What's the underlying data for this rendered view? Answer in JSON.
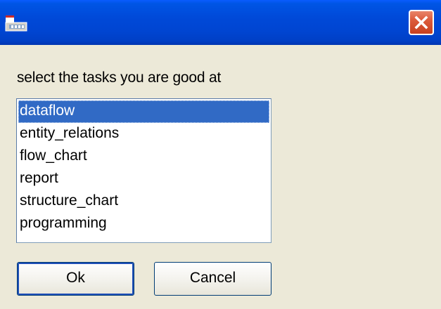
{
  "window": {
    "title": "",
    "close_icon": "close-icon"
  },
  "dialog": {
    "prompt": "select the tasks you are good at",
    "tasks": [
      {
        "label": "dataflow",
        "selected": true
      },
      {
        "label": "entity_relations",
        "selected": false
      },
      {
        "label": "flow_chart",
        "selected": false
      },
      {
        "label": "report",
        "selected": false
      },
      {
        "label": "structure_chart",
        "selected": false
      },
      {
        "label": "programming",
        "selected": false
      }
    ],
    "ok_label": "Ok",
    "cancel_label": "Cancel"
  },
  "colors": {
    "titlebar": "#0049d8",
    "selection": "#316ac5",
    "close_button": "#dc5b3b",
    "dialog_background": "#ece9d8"
  }
}
